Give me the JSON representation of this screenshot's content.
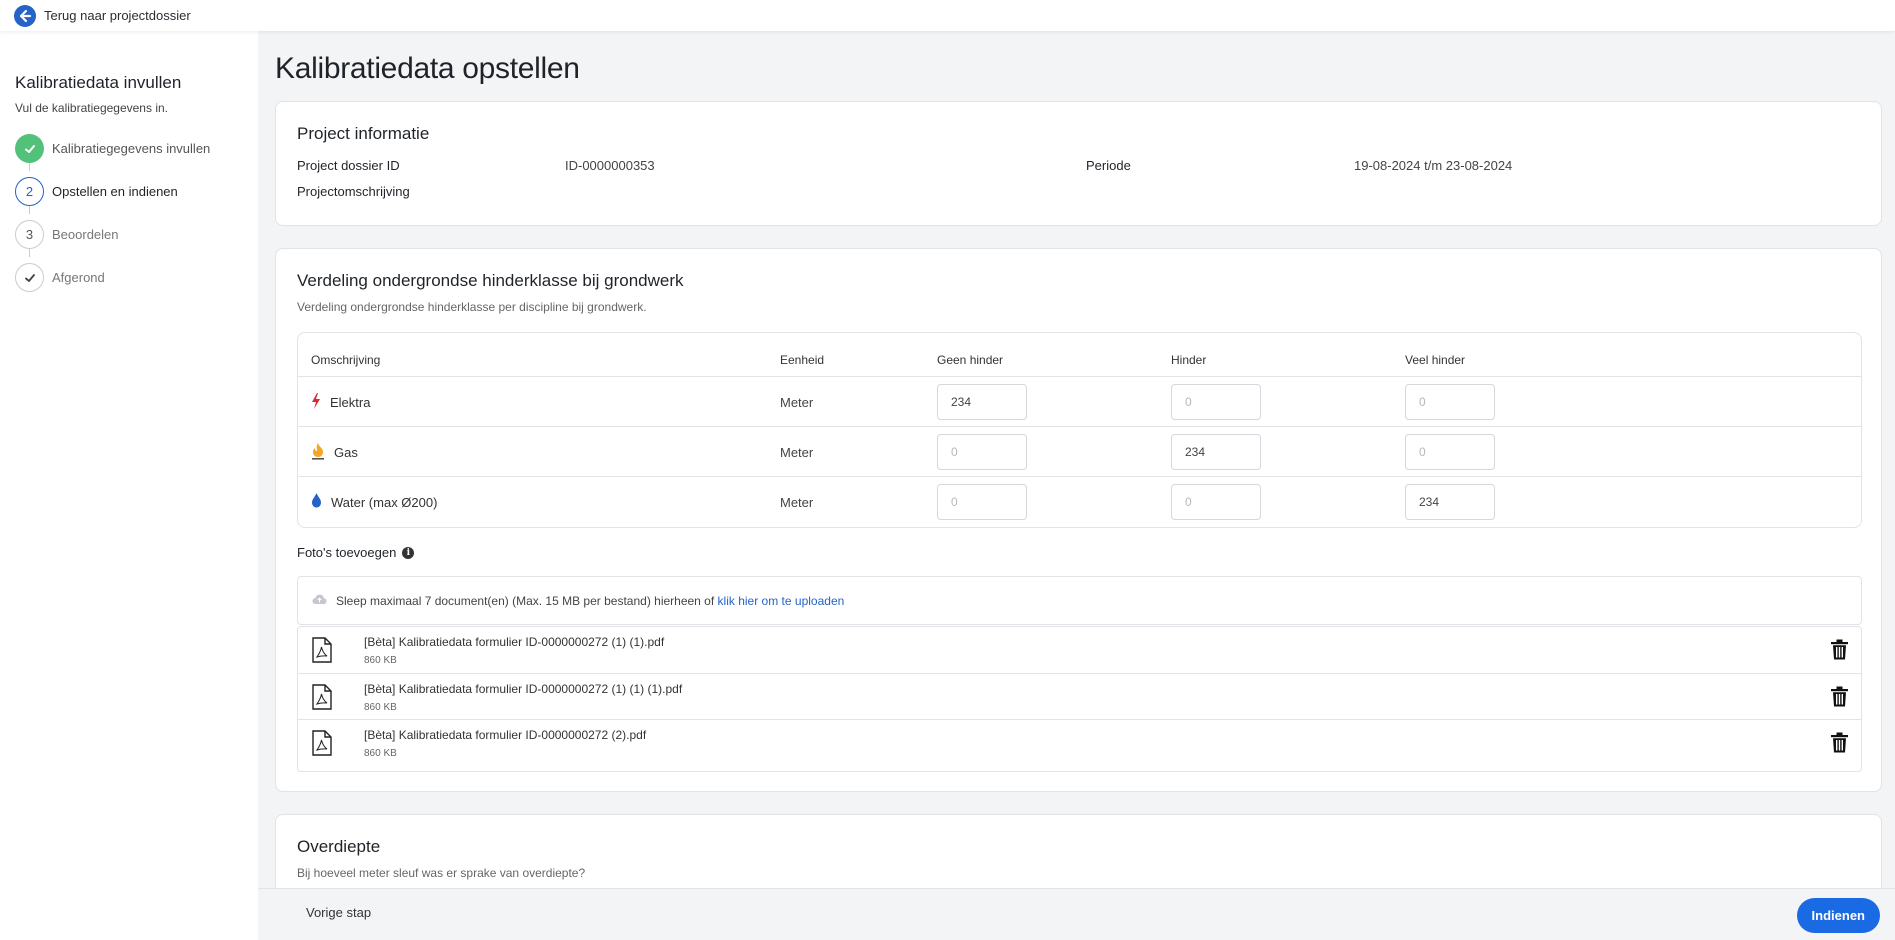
{
  "topbar": {
    "back_label": "Terug naar projectdossier",
    "back_icon": "arrow-left-icon"
  },
  "sidebar": {
    "title": "Kalibratiedata invullen",
    "subtitle": "Vul de kalibratiegegevens in.",
    "steps": [
      {
        "marker": "",
        "label": "Kalibratiegegevens invullen",
        "state": "done"
      },
      {
        "marker": "2",
        "label": "Opstellen en indienen",
        "state": "active"
      },
      {
        "marker": "3",
        "label": "Beoordelen",
        "state": "todo"
      },
      {
        "marker": "",
        "label": "Afgerond",
        "state": "final"
      }
    ]
  },
  "page": {
    "title": "Kalibratiedata opstellen"
  },
  "project_info": {
    "title": "Project informatie",
    "dossier_label": "Project dossier ID",
    "dossier_value": "ID-0000000353",
    "period_label": "Periode",
    "period_value": "19-08-2024 t/m 23-08-2024",
    "description_label": "Projectomschrijving",
    "description_value": ""
  },
  "verdeling": {
    "title": "Verdeling ondergrondse hinderklasse bij grondwerk",
    "subtitle": "Verdeling ondergrondse hinderklasse per discipline bij grondwerk.",
    "columns": [
      "Omschrijving",
      "Eenheid",
      "Geen hinder",
      "Hinder",
      "Veel hinder"
    ],
    "rows": [
      {
        "icon": "lightning-icon",
        "name": "Elektra",
        "unit": "Meter",
        "geen": "234",
        "hinder": "",
        "veel": ""
      },
      {
        "icon": "flame-icon",
        "name": "Gas",
        "unit": "Meter",
        "geen": "",
        "hinder": "234",
        "veel": ""
      },
      {
        "icon": "water-drop-icon",
        "name": "Water (max Ø200)",
        "unit": "Meter",
        "geen": "",
        "hinder": "",
        "veel": "234"
      }
    ],
    "input_placeholder": "0"
  },
  "photos": {
    "label": "Foto's toevoegen",
    "dropzone_text": "Sleep maximaal 7 document(en) (Max. 15 MB per bestand) hierheen of",
    "dropzone_link": "klik hier om te uploaden",
    "files": [
      {
        "name": "[Bèta] Kalibratiedata formulier ID-0000000272 (1) (1).pdf",
        "size": "860 KB"
      },
      {
        "name": "[Bèta] Kalibratiedata formulier ID-0000000272 (1) (1) (1).pdf",
        "size": "860 KB"
      },
      {
        "name": "[Bèta] Kalibratiedata formulier ID-0000000272 (2).pdf",
        "size": "860 KB"
      }
    ]
  },
  "overdiepte": {
    "title": "Overdiepte",
    "subtitle": "Bij hoeveel meter sleuf was er sprake van overdiepte?"
  },
  "footer": {
    "prev_label": "Vorige stap",
    "submit_label": "Indienen"
  },
  "colors": {
    "accent": "#1a6ae4",
    "success": "#52c27a",
    "elektra": "#d32f2f",
    "gas": "#f5a623",
    "water": "#2563c9"
  }
}
